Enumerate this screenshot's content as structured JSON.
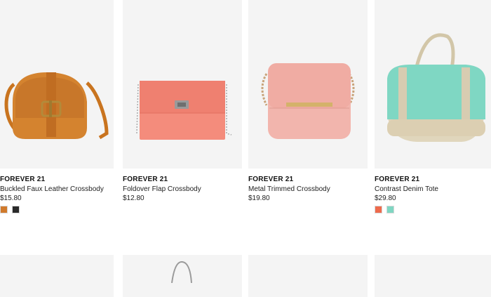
{
  "products": [
    {
      "brand": "FOREVER 21",
      "name": "Buckled Faux Leather Crossbody",
      "price": "$15.80",
      "image": "orange-crossbody-bag",
      "swatches": [
        "#d07a2c",
        "#2a2a2a"
      ]
    },
    {
      "brand": "FOREVER 21",
      "name": "Foldover Flap Crossbody",
      "price": "$12.80",
      "image": "coral-foldover-crossbody",
      "swatches": []
    },
    {
      "brand": "FOREVER 21",
      "name": "Metal Trimmed Crossbody",
      "price": "$19.80",
      "image": "pink-metal-trim-crossbody",
      "swatches": []
    },
    {
      "brand": "FOREVER 21",
      "name": "Contrast Denim Tote",
      "price": "$29.80",
      "image": "mint-contrast-tote",
      "swatches": [
        "#ee6a4c",
        "#7fd6c2"
      ]
    }
  ]
}
